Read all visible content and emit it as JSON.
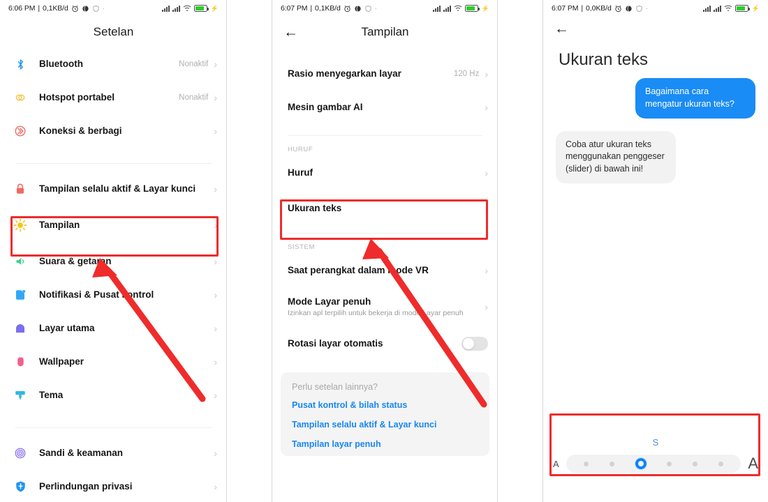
{
  "colors": {
    "accent_blue": "#1a8cf5",
    "link_blue": "#1887f2",
    "annotation_red": "#ef2b2b",
    "slider_blue": "#0a84ff",
    "battery_green": "#2ecc2e"
  },
  "panel1": {
    "statusbar": {
      "time": "6:06 PM",
      "separator": "|",
      "data_rate": "0,1KB/d",
      "icons": [
        "alarm-icon",
        "globe-icon",
        "shield-icon",
        "dot-icon"
      ],
      "right_icons": [
        "signal-bars-icon",
        "signal-bars-icon",
        "wifi-icon",
        "battery-icon",
        "charging-bolt-icon"
      ]
    },
    "title": "Setelan",
    "rows": [
      {
        "icon": "bluetooth-icon",
        "label": "Bluetooth",
        "value": "Nonaktif",
        "chevron": "›"
      },
      {
        "icon": "hotspot-icon",
        "label": "Hotspot portabel",
        "value": "Nonaktif",
        "chevron": "›"
      },
      {
        "icon": "connection-share-icon",
        "label": "Koneksi & berbagi",
        "value": "",
        "chevron": "›"
      },
      {
        "icon": "lock-icon",
        "label": "Tampilan selalu aktif & Layar kunci",
        "value": "",
        "chevron": "›"
      },
      {
        "icon": "brightness-icon",
        "label": "Tampilan",
        "value": "",
        "chevron": "›"
      },
      {
        "icon": "speaker-icon",
        "label": "Suara & getaran",
        "value": "",
        "chevron": "›"
      },
      {
        "icon": "notification-icon",
        "label": "Notifikasi & Pusat kontrol",
        "value": "",
        "chevron": "›"
      },
      {
        "icon": "home-icon",
        "label": "Layar utama",
        "value": "",
        "chevron": "›"
      },
      {
        "icon": "wallpaper-icon",
        "label": "Wallpaper",
        "value": "",
        "chevron": "›"
      },
      {
        "icon": "theme-brush-icon",
        "label": "Tema",
        "value": "",
        "chevron": "›"
      },
      {
        "icon": "fingerprint-icon",
        "label": "Sandi & keamanan",
        "value": "",
        "chevron": "›"
      },
      {
        "icon": "privacy-shield-icon",
        "label": "Perlindungan privasi",
        "value": "",
        "chevron": "›"
      }
    ]
  },
  "panel2": {
    "statusbar": {
      "time": "6:07 PM",
      "separator": "|",
      "data_rate": "0,1KB/d"
    },
    "back": "←",
    "title": "Tampilan",
    "rows_top": [
      {
        "label": "Rasio menyegarkan layar",
        "value": "120 Hz",
        "chevron": "›"
      },
      {
        "label": "Mesin gambar AI",
        "value": "",
        "chevron": "›"
      }
    ],
    "group_font": "HURUF",
    "rows_font": [
      {
        "label": "Huruf",
        "value": "",
        "chevron": "›"
      },
      {
        "label": "Ukuran teks",
        "value": "",
        "chevron": "›"
      }
    ],
    "group_system": "SISTEM",
    "rows_system": [
      {
        "label": "Saat perangkat dalam mode VR",
        "sub": "",
        "value": "",
        "chevron": "›"
      },
      {
        "label": "Mode Layar penuh",
        "sub": "Izinkan apl terpilih untuk bekerja di mode Layar penuh",
        "value": "",
        "chevron": "›"
      }
    ],
    "toggle_row": {
      "label": "Rotasi layar otomatis",
      "state": "off"
    },
    "more_card": {
      "heading": "Perlu setelan lainnya?",
      "links": [
        "Pusat kontrol & bilah status",
        "Tampilan selalu aktif & Layar kunci",
        "Tampilan layar penuh"
      ]
    }
  },
  "panel3": {
    "statusbar": {
      "time": "6:07 PM",
      "separator": "|",
      "data_rate": "0,0KB/d"
    },
    "back": "←",
    "title": "Ukuran teks",
    "bubbles": [
      {
        "side": "out",
        "text": "Bagaimana cara mengatur ukuran teks?"
      },
      {
        "side": "in",
        "text": "Coba atur ukuran teks menggunakan penggeser (slider) di bawah ini!"
      }
    ],
    "slider": {
      "current_label": "S",
      "small_letter": "A",
      "large_letter": "A",
      "steps": 6,
      "active_index": 2
    }
  },
  "annotations": {
    "boxes": [
      {
        "name": "highlight-tampilan-row"
      },
      {
        "name": "highlight-ukuran-teks-row"
      },
      {
        "name": "highlight-text-size-slider"
      }
    ],
    "arrows": [
      {
        "name": "arrow-to-tampilan"
      },
      {
        "name": "arrow-to-ukuran-teks"
      }
    ]
  }
}
